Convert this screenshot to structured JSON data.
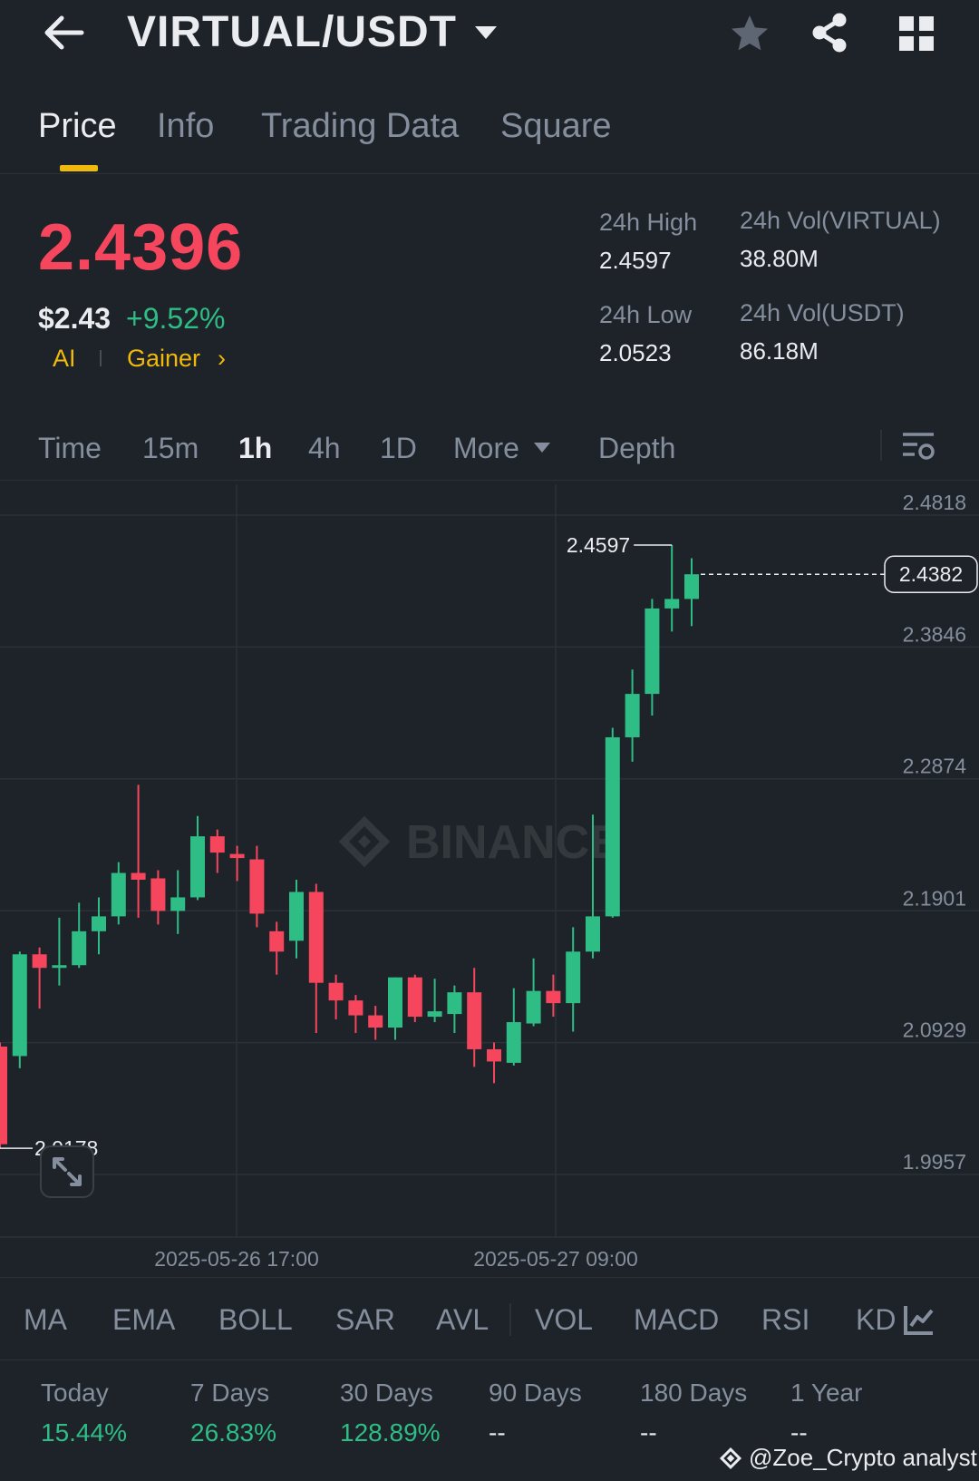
{
  "header": {
    "pair": "VIRTUAL/USDT"
  },
  "tabs": [
    {
      "label": "Price",
      "active": true
    },
    {
      "label": "Info"
    },
    {
      "label": "Trading Data"
    },
    {
      "label": "Square"
    }
  ],
  "ticker": {
    "last_price": "2.4396",
    "usd_price": "$2.43",
    "change_pct": "+9.52%",
    "tags": [
      "AI",
      "Gainer"
    ],
    "high_label": "24h High",
    "high_value": "2.4597",
    "low_label": "24h Low",
    "low_value": "2.0523",
    "vol_base_label": "24h Vol(VIRTUAL)",
    "vol_base_value": "38.80M",
    "vol_quote_label": "24h Vol(USDT)",
    "vol_quote_value": "86.18M"
  },
  "intervals": [
    {
      "label": "Time"
    },
    {
      "label": "15m"
    },
    {
      "label": "1h",
      "active": true
    },
    {
      "label": "4h"
    },
    {
      "label": "1D"
    },
    {
      "label": "More"
    },
    {
      "label": "Depth"
    }
  ],
  "chart_data": {
    "type": "candlestick",
    "y_ticks": [
      "2.4818",
      "2.3846",
      "2.2874",
      "2.1901",
      "2.0929",
      "1.9957"
    ],
    "ylim": [
      1.9957,
      2.4818
    ],
    "x_ticks": [
      "2025-05-26 17:00",
      "2025-05-27 09:00"
    ],
    "last_price_label": "2.4382",
    "high_marker": "2.4597",
    "low_marker": "2.0178",
    "watermark": "BINANCE",
    "colors": {
      "up": "#2ebd85",
      "down": "#f6465d",
      "grid": "#2b3139",
      "axis_text": "#848e9c"
    },
    "candles": [
      {
        "o": 2.09,
        "h": 2.093,
        "l": 2.015,
        "c": 2.018
      },
      {
        "o": 2.083,
        "h": 2.16,
        "l": 2.074,
        "c": 2.158
      },
      {
        "o": 2.158,
        "h": 2.163,
        "l": 2.118,
        "c": 2.148
      },
      {
        "o": 2.148,
        "h": 2.185,
        "l": 2.135,
        "c": 2.15
      },
      {
        "o": 2.15,
        "h": 2.196,
        "l": 2.148,
        "c": 2.175
      },
      {
        "o": 2.175,
        "h": 2.2,
        "l": 2.158,
        "c": 2.186
      },
      {
        "o": 2.186,
        "h": 2.226,
        "l": 2.18,
        "c": 2.218
      },
      {
        "o": 2.218,
        "h": 2.283,
        "l": 2.185,
        "c": 2.213
      },
      {
        "o": 2.214,
        "h": 2.22,
        "l": 2.18,
        "c": 2.19
      },
      {
        "o": 2.19,
        "h": 2.22,
        "l": 2.173,
        "c": 2.2
      },
      {
        "o": 2.2,
        "h": 2.26,
        "l": 2.198,
        "c": 2.245
      },
      {
        "o": 2.245,
        "h": 2.25,
        "l": 2.218,
        "c": 2.233
      },
      {
        "o": 2.232,
        "h": 2.238,
        "l": 2.212,
        "c": 2.229
      },
      {
        "o": 2.228,
        "h": 2.238,
        "l": 2.178,
        "c": 2.188
      },
      {
        "o": 2.175,
        "h": 2.182,
        "l": 2.143,
        "c": 2.16
      },
      {
        "o": 2.168,
        "h": 2.213,
        "l": 2.155,
        "c": 2.204
      },
      {
        "o": 2.204,
        "h": 2.21,
        "l": 2.1,
        "c": 2.137
      },
      {
        "o": 2.137,
        "h": 2.143,
        "l": 2.11,
        "c": 2.124
      },
      {
        "o": 2.124,
        "h": 2.128,
        "l": 2.1,
        "c": 2.113
      },
      {
        "o": 2.113,
        "h": 2.12,
        "l": 2.095,
        "c": 2.104
      },
      {
        "o": 2.104,
        "h": 2.141,
        "l": 2.095,
        "c": 2.141
      },
      {
        "o": 2.141,
        "h": 2.143,
        "l": 2.108,
        "c": 2.112
      },
      {
        "o": 2.112,
        "h": 2.14,
        "l": 2.108,
        "c": 2.116
      },
      {
        "o": 2.114,
        "h": 2.135,
        "l": 2.1,
        "c": 2.13
      },
      {
        "o": 2.13,
        "h": 2.148,
        "l": 2.075,
        "c": 2.088
      },
      {
        "o": 2.088,
        "h": 2.093,
        "l": 2.063,
        "c": 2.079
      },
      {
        "o": 2.078,
        "h": 2.133,
        "l": 2.076,
        "c": 2.108
      },
      {
        "o": 2.107,
        "h": 2.155,
        "l": 2.105,
        "c": 2.131
      },
      {
        "o": 2.131,
        "h": 2.143,
        "l": 2.112,
        "c": 2.122
      },
      {
        "o": 2.122,
        "h": 2.178,
        "l": 2.101,
        "c": 2.16
      },
      {
        "o": 2.16,
        "h": 2.261,
        "l": 2.155,
        "c": 2.186
      },
      {
        "o": 2.186,
        "h": 2.325,
        "l": 2.185,
        "c": 2.318
      },
      {
        "o": 2.318,
        "h": 2.368,
        "l": 2.3,
        "c": 2.35
      },
      {
        "o": 2.35,
        "h": 2.42,
        "l": 2.334,
        "c": 2.413
      },
      {
        "o": 2.413,
        "h": 2.4597,
        "l": 2.396,
        "c": 2.42
      },
      {
        "o": 2.42,
        "h": 2.45,
        "l": 2.4,
        "c": 2.4382
      }
    ]
  },
  "indicators": [
    "MA",
    "EMA",
    "BOLL",
    "SAR",
    "AVL",
    "VOL",
    "MACD",
    "RSI",
    "KD"
  ],
  "performance": [
    {
      "label": "Today",
      "value": "15.44%"
    },
    {
      "label": "7 Days",
      "value": "26.83%"
    },
    {
      "label": "30 Days",
      "value": "128.89%"
    },
    {
      "label": "90 Days",
      "value": "--"
    },
    {
      "label": "180 Days",
      "value": "--"
    },
    {
      "label": "1 Year",
      "value": "--"
    }
  ],
  "watermark_text": "@Zoe_Crypto analyst"
}
